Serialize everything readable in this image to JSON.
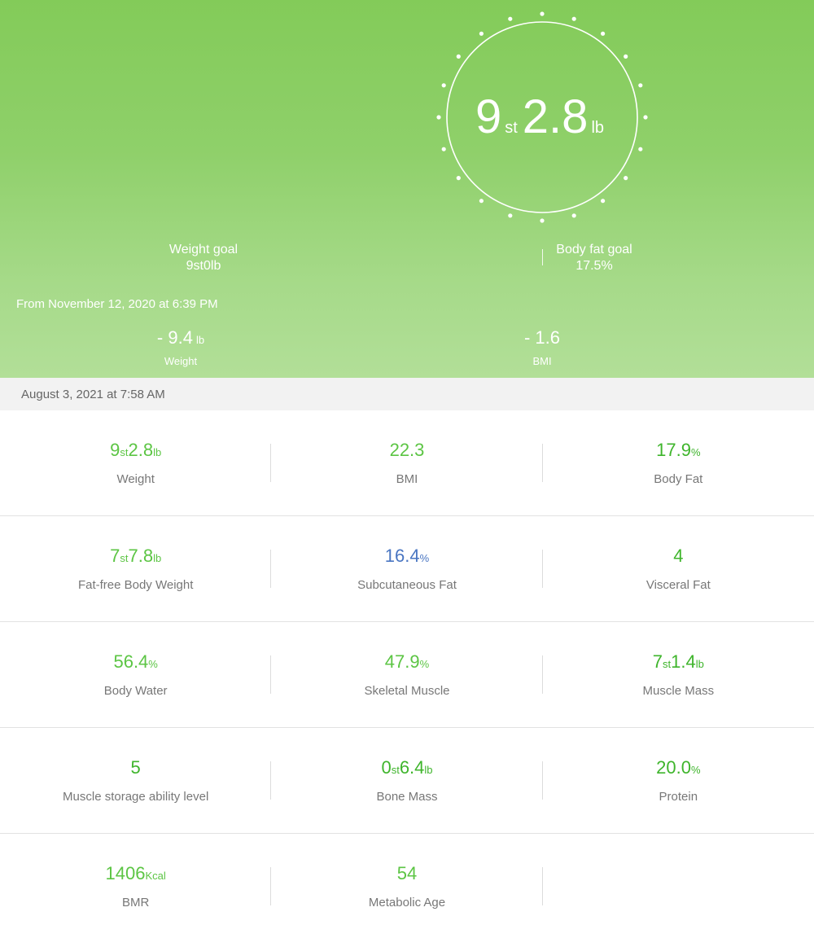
{
  "hero": {
    "weight_major": "9",
    "weight_major_unit": "st",
    "weight_minor": "2.8",
    "weight_minor_unit": "lb",
    "weight_goal_label": "Weight goal",
    "weight_goal_value": "9st0lb",
    "fat_goal_label": "Body fat goal",
    "fat_goal_value": "17.5%",
    "from_text": "From November 12, 2020 at 6:39 PM",
    "delta_weight_value": "- 9.4",
    "delta_weight_unit": "lb",
    "delta_weight_label": "Weight",
    "delta_bmi_value": "- 1.6",
    "delta_bmi_label": "BMI"
  },
  "date_bar": "August 3, 2021 at 7:58 AM",
  "metrics": {
    "weight": {
      "a": "9",
      "au": "st",
      "b": "2.8",
      "bu": "lb",
      "label": "Weight"
    },
    "bmi": {
      "value": "22.3",
      "label": "BMI"
    },
    "body_fat": {
      "value": "17.9",
      "unit": "%",
      "label": "Body Fat"
    },
    "fat_free": {
      "a": "7",
      "au": "st",
      "b": "7.8",
      "bu": "lb",
      "label": "Fat-free Body Weight"
    },
    "subcutaneous": {
      "value": "16.4",
      "unit": "%",
      "label": "Subcutaneous Fat"
    },
    "visceral": {
      "value": "4",
      "label": "Visceral Fat"
    },
    "body_water": {
      "value": "56.4",
      "unit": "%",
      "label": "Body Water"
    },
    "skeletal": {
      "value": "47.9",
      "unit": "%",
      "label": "Skeletal Muscle"
    },
    "muscle_mass": {
      "a": "7",
      "au": "st",
      "b": "1.4",
      "bu": "lb",
      "label": "Muscle Mass"
    },
    "storage": {
      "value": "5",
      "label": "Muscle storage ability level"
    },
    "bone_mass": {
      "a": "0",
      "au": "st",
      "b": "6.4",
      "bu": "lb",
      "label": "Bone Mass"
    },
    "protein": {
      "value": "20.0",
      "unit": "%",
      "label": "Protein"
    },
    "bmr": {
      "value": "1406",
      "unit": "Kcal",
      "label": "BMR"
    },
    "metabolic_age": {
      "value": "54",
      "label": "Metabolic Age"
    }
  },
  "colors": {
    "accent_green": "#5cc544",
    "accent_blue": "#4a76c2",
    "hero_top": "#83cb59",
    "hero_bottom": "#b2df98"
  }
}
